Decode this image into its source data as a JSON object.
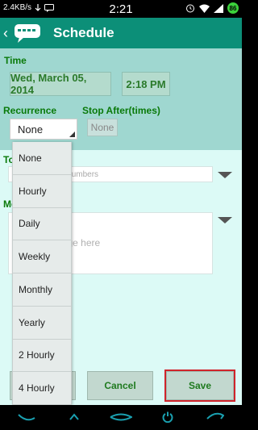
{
  "status_bar": {
    "data_rate": "2.4KB/s",
    "time": "2:21",
    "battery_level": "86"
  },
  "action_bar": {
    "title": "Schedule",
    "back_icon": "chevron-left-icon",
    "app_icon": "chat-bubble-icon"
  },
  "form": {
    "time_label": "Time",
    "date_value": "Wed, March 05, 2014",
    "time_value": "2:18 PM",
    "recurrence_label": "Recurrence",
    "recurrence_selected": "None",
    "stop_after_label": "Stop After(times)",
    "stop_after_value": "None",
    "to_label": "To",
    "to_placeholder": "Enter name or numbers",
    "message_label": "Message",
    "message_placeholder": "Write message here"
  },
  "recurrence_options": [
    "None",
    "Hourly",
    "Daily",
    "Weekly",
    "Monthly",
    "Yearly",
    "2 Hourly",
    "4 Hourly"
  ],
  "buttons": {
    "cancel": "Cancel",
    "save": "Save"
  },
  "colors": {
    "action_bar": "#0c8f78",
    "time_panel": "#9fd7d0",
    "content_bg": "#dcfaf6",
    "label_green": "#0a7a0a",
    "save_highlight": "#d0242b"
  }
}
